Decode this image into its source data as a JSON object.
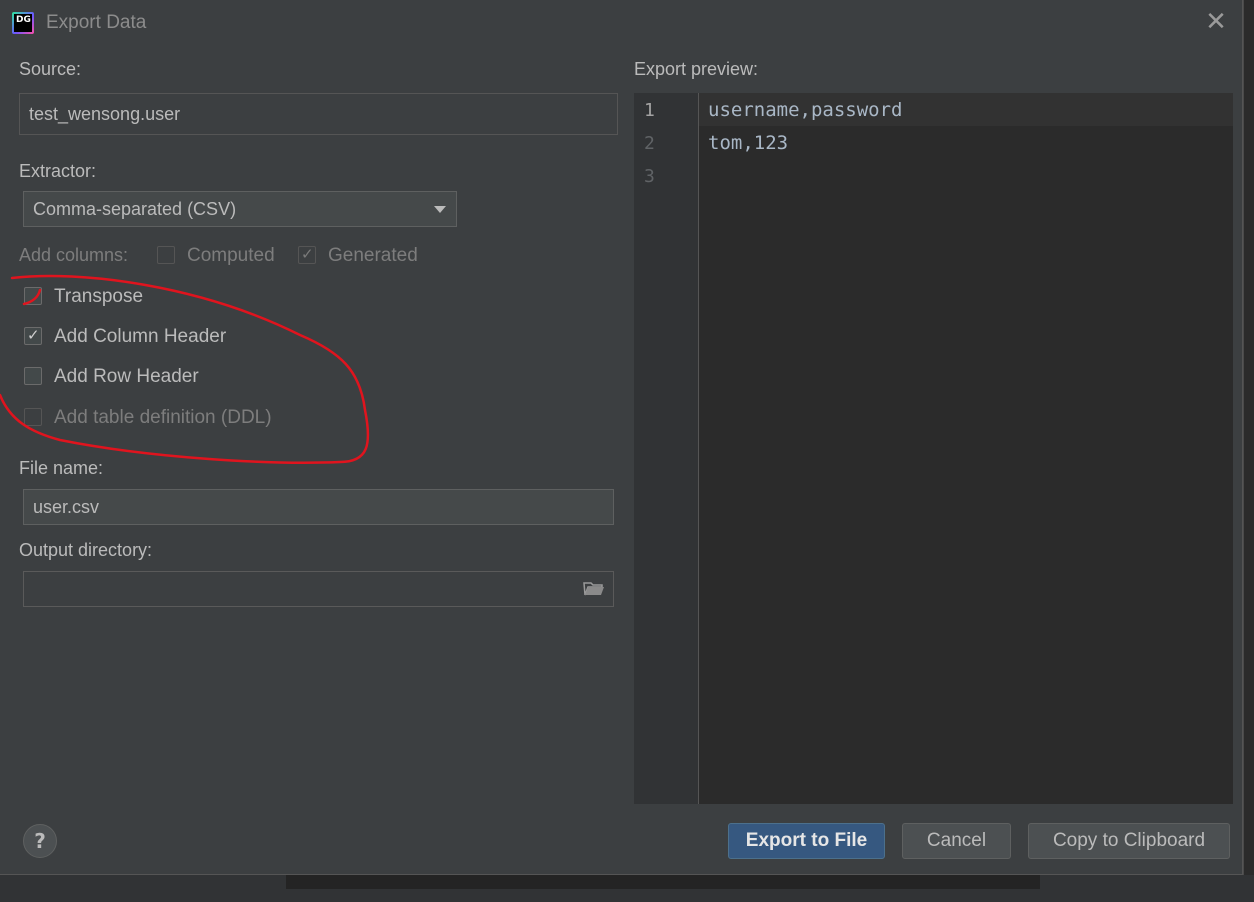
{
  "window": {
    "title": "Export Data",
    "app_icon_text": "DG"
  },
  "source": {
    "label": "Source:",
    "value": "test_wensong.user"
  },
  "extractor": {
    "label": "Extractor:",
    "selected": "Comma-separated (CSV)"
  },
  "add_columns": {
    "label": "Add columns:",
    "computed": {
      "label": "Computed",
      "checked": false
    },
    "generated": {
      "label": "Generated",
      "checked": true
    }
  },
  "options": {
    "transpose": {
      "label": "Transpose",
      "checked": false
    },
    "add_column_header": {
      "label": "Add Column Header",
      "checked": true
    },
    "add_row_header": {
      "label": "Add Row Header",
      "checked": false
    },
    "add_table_definition": {
      "label": "Add table definition (DDL)",
      "checked": false
    }
  },
  "file_name": {
    "label": "File name:",
    "value": "user.csv"
  },
  "output_directory": {
    "label": "Output directory:",
    "value": ""
  },
  "preview": {
    "label": "Export preview:",
    "line_numbers": [
      "1",
      "2",
      "3"
    ],
    "lines": [
      "username,password",
      "tom,123",
      ""
    ]
  },
  "buttons": {
    "export": "Export to File",
    "cancel": "Cancel",
    "copy": "Copy to Clipboard",
    "help": "?"
  },
  "icons": {
    "close": "close-icon",
    "folder": "folder-icon",
    "dropdown": "chevron-down-icon",
    "help": "help-icon"
  },
  "colors": {
    "dialog_bg": "#3c3f41",
    "editor_bg": "#2b2b2b",
    "primary_button": "#365880",
    "annotation_stroke": "#e0141e"
  }
}
